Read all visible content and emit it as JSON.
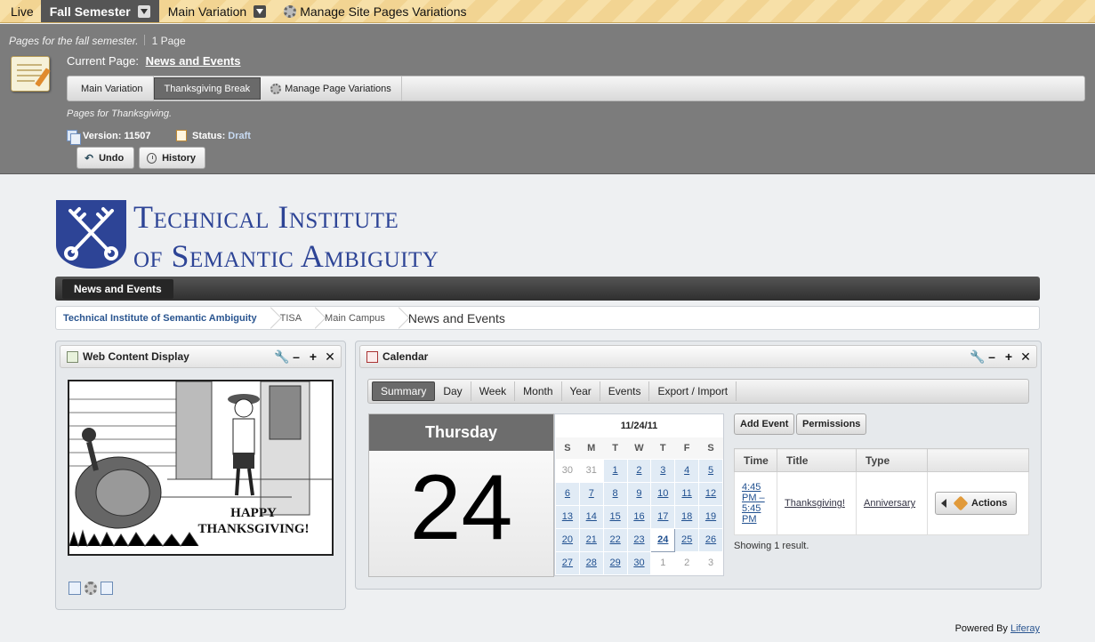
{
  "topbar": {
    "live": "Live",
    "fall_semester": "Fall Semester",
    "main_variation": "Main Variation",
    "manage_site_pages_variations": "Manage Site Pages Variations"
  },
  "staging": {
    "description": "Pages for the fall semester.",
    "page_count": "1 Page",
    "current_page_label": "Current Page:",
    "current_page": "News and Events",
    "variations": {
      "main": "Main Variation",
      "thanksgiving": "Thanksgiving Break",
      "manage": "Manage Page Variations"
    },
    "variation_description": "Pages for Thanksgiving.",
    "version_label": "Version: 11507",
    "status_label": "Status:",
    "status_value": "Draft",
    "undo": "Undo",
    "history": "History"
  },
  "logo": {
    "line1": "Technical Institute",
    "line2": "of Semantic Ambiguity"
  },
  "nav": {
    "item": "News and Events"
  },
  "breadcrumb": [
    "Technical Institute of Semantic Ambiguity",
    "TISA",
    "Main Campus",
    "News and Events"
  ],
  "wcd": {
    "title": "Web Content Display",
    "image_text_1": "HAPPY",
    "image_text_2": "THANKSGIVING!"
  },
  "calendar": {
    "title": "Calendar",
    "tabs": [
      "Summary",
      "Day",
      "Week",
      "Month",
      "Year",
      "Events",
      "Export / Import"
    ],
    "day_name": "Thursday",
    "day_number": "24",
    "mini_title": "11/24/11",
    "weekdays": [
      "S",
      "M",
      "T",
      "W",
      "T",
      "F",
      "S"
    ],
    "weeks": [
      [
        "30",
        "31",
        "1",
        "2",
        "3",
        "4",
        "5"
      ],
      [
        "6",
        "7",
        "8",
        "9",
        "10",
        "11",
        "12"
      ],
      [
        "13",
        "14",
        "15",
        "16",
        "17",
        "18",
        "19"
      ],
      [
        "20",
        "21",
        "22",
        "23",
        "24",
        "25",
        "26"
      ],
      [
        "27",
        "28",
        "29",
        "30",
        "1",
        "2",
        "3"
      ]
    ],
    "add_event": "Add Event",
    "permissions": "Permissions",
    "columns": [
      "Time",
      "Title",
      "Type",
      ""
    ],
    "events": [
      {
        "time": "4:45 PM – 5:45 PM",
        "title": "Thanksgiving!",
        "type": "Anniversary",
        "actions": "Actions"
      }
    ],
    "showing": "Showing 1 result."
  },
  "footer": {
    "powered_by": "Powered By",
    "liferay": "Liferay"
  }
}
